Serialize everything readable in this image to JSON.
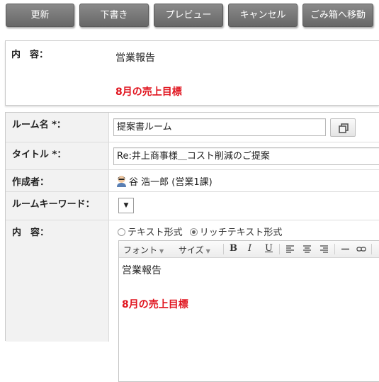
{
  "toolbar": {
    "update": "更新",
    "draft": "下書き",
    "preview": "プレビュー",
    "cancel": "キャンセル",
    "trash": "ごみ箱へ移動"
  },
  "preview": {
    "label": "内　容：",
    "line1": "営業報告",
    "line2": "8月の売上目標"
  },
  "form": {
    "room_name": {
      "label": "ルーム名 *：",
      "value": "提案書ルーム"
    },
    "title": {
      "label": "タイトル *：",
      "value": "Re:井上商事様＿コスト削減のご提案"
    },
    "creator": {
      "label": "作成者：",
      "name": "谷 浩一郎 (営業1課)"
    },
    "keyword": {
      "label": "ルームキーワード：",
      "select_glyph": "▼"
    },
    "content": {
      "label": "内　容：",
      "format_options": [
        "テキスト形式",
        "リッチテキスト形式"
      ],
      "selected_format": "リッチテキスト形式",
      "editor_toolbar": {
        "font": "フォント",
        "size": "サイズ",
        "dropdown_glyph": "▼",
        "bold": "B",
        "italic": "I",
        "underline": "U"
      },
      "body_line1": "営業報告",
      "body_line2": "8月の売上目標"
    }
  },
  "colors": {
    "toolbar_button": "#777777",
    "highlight_text": "#e0141e",
    "label_background": "#f2f2f2"
  }
}
